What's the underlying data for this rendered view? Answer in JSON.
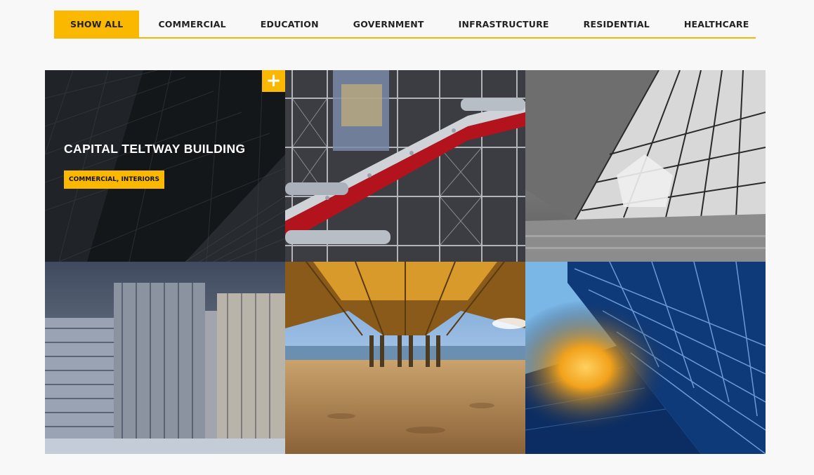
{
  "filters": {
    "items": [
      {
        "label": "SHOW ALL",
        "active": true
      },
      {
        "label": "COMMERCIAL",
        "active": false
      },
      {
        "label": "EDUCATION",
        "active": false
      },
      {
        "label": "GOVERNMENT",
        "active": false
      },
      {
        "label": "INFRASTRUCTURE",
        "active": false
      },
      {
        "label": "RESIDENTIAL",
        "active": false
      },
      {
        "label": "HEALTHCARE",
        "active": false
      }
    ]
  },
  "portfolio": {
    "featured": {
      "title": "CAPITAL TELTWAY BUILDING",
      "tags": "COMMERCIAL, INTERIORS",
      "plus_icon": "+"
    }
  },
  "colors": {
    "accent": "#fbb800",
    "background": "#f8f8f8"
  }
}
